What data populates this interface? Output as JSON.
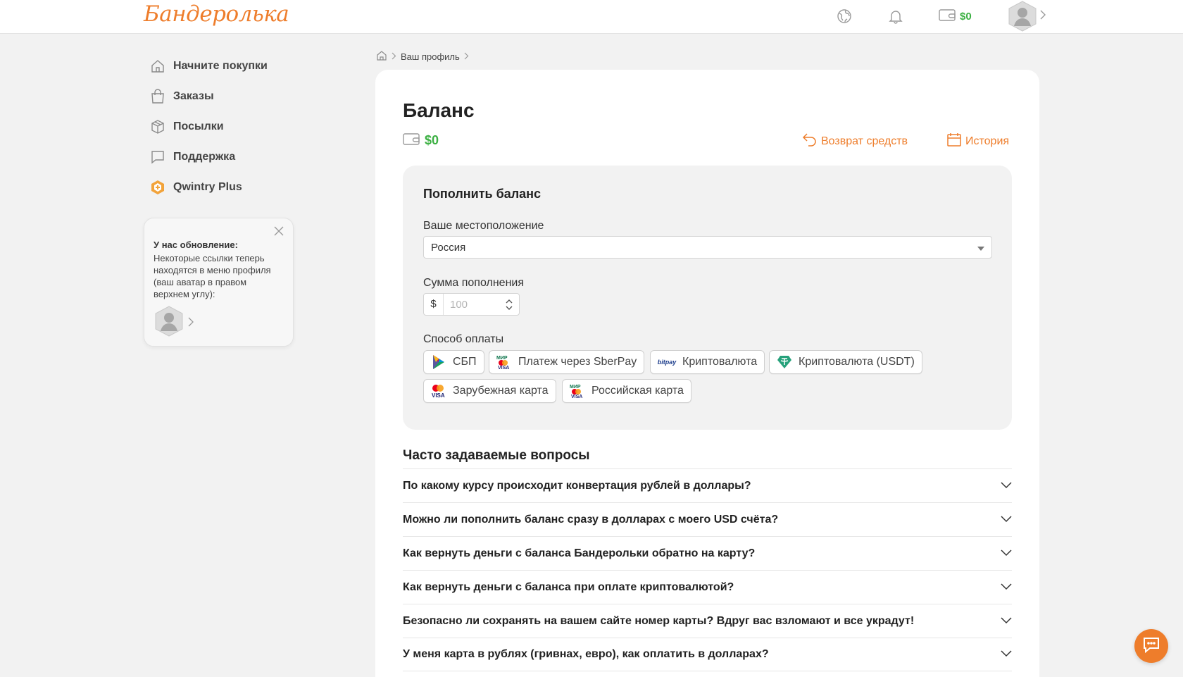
{
  "header": {
    "logo": "Бандеролька",
    "wallet_amount": "$0",
    "icons": [
      "globe-icon",
      "bell-icon",
      "wallet-icon"
    ]
  },
  "sidebar": {
    "items": [
      {
        "label": "Начните покупки",
        "icon": "home-icon"
      },
      {
        "label": "Заказы",
        "icon": "shopping-bag-icon"
      },
      {
        "label": "Посылки",
        "icon": "box-icon"
      },
      {
        "label": "Поддержка",
        "icon": "chat-bubble-icon"
      },
      {
        "label": "Qwintry Plus",
        "icon": "qwintry-plus-icon"
      }
    ],
    "notice": {
      "title": "У нас обновление:",
      "text": "Некоторые ссылки теперь находятся в меню профиля (ваш аватар в правом верхнем углу):"
    }
  },
  "breadcrumb": {
    "items": [
      "Ваш профиль"
    ]
  },
  "balance": {
    "title": "Баланс",
    "amount": "$0",
    "refund_label": "Возврат средств",
    "history_label": "История"
  },
  "topup": {
    "title": "Пополнить баланс",
    "location_label": "Ваше местоположение",
    "location_value": "Россия",
    "amount_label": "Сумма пополнения",
    "currency": "$",
    "amount_placeholder": "100",
    "method_label": "Способ оплаты",
    "methods": [
      {
        "label": "СБП",
        "icon": "sbp-icon"
      },
      {
        "label": "Платеж через SberPay",
        "icon": "mir-visa-icon"
      },
      {
        "label": "Криптовалюта",
        "icon": "bitpay-icon"
      },
      {
        "label": "Криптовалюта (USDT)",
        "icon": "tether-icon"
      },
      {
        "label": "Зарубежная карта",
        "icon": "mastercard-visa-icon"
      },
      {
        "label": "Российская карта",
        "icon": "mir-visa-icon"
      }
    ],
    "bitpay_text": "bitpay"
  },
  "faq": {
    "title": "Часто задаваемые вопросы",
    "questions": [
      "По какому курсу происходит конвертация рублей в доллары?",
      "Можно ли пополнить баланс сразу в долларах с моего USD счёта?",
      "Как вернуть деньги с баланса Бандерольки обратно на карту?",
      "Как вернуть деньги с баланса при оплате криптовалютой?",
      "Безопасно ли сохранять на вашем сайте номер карты? Вдруг вас взломают и все украдут!",
      "У меня карта в рублях (гривнах, евро), как оплатить в долларах?"
    ]
  },
  "colors": {
    "brand": "#ee7d2b",
    "balance_green": "#3cb043",
    "background": "#f2f2f2"
  }
}
